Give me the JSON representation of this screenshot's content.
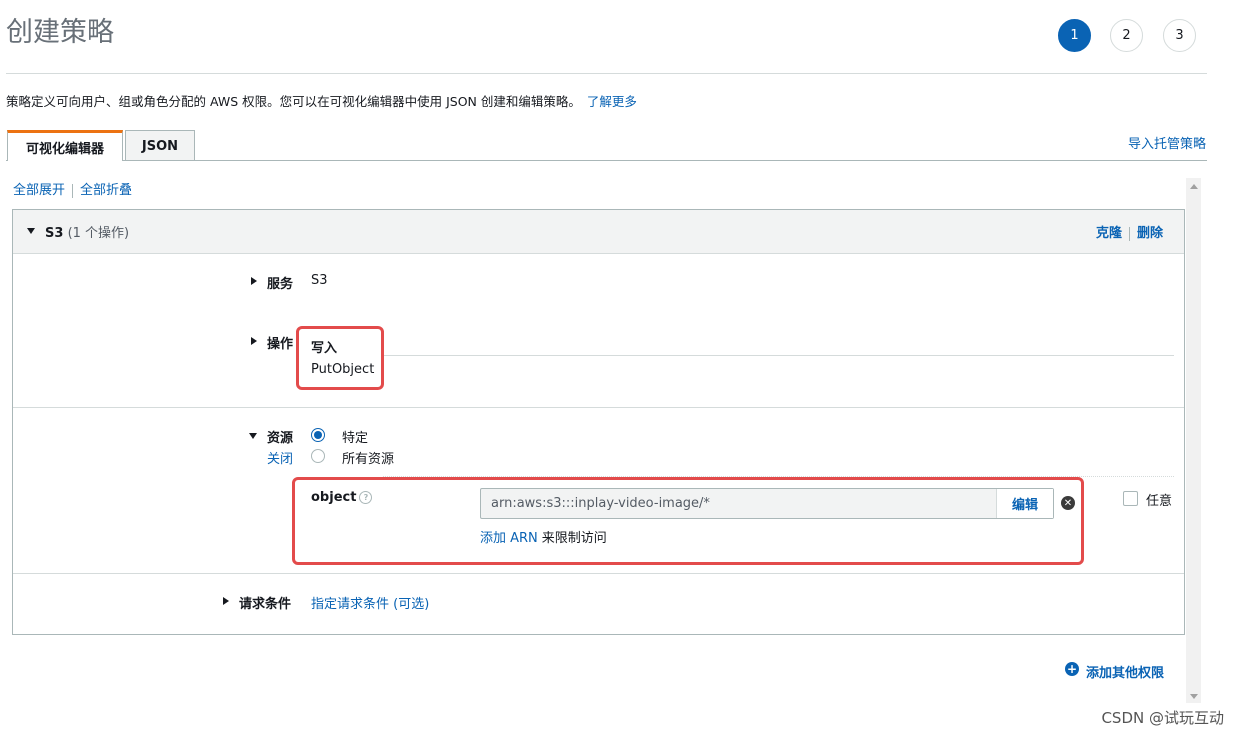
{
  "page": {
    "title": "创建策略",
    "steps": [
      "1",
      "2",
      "3"
    ],
    "description": "策略定义可向用户、组或角色分配的 AWS 权限。您可以在可视化编辑器中使用 JSON 创建和编辑策略。",
    "learn_more": "了解更多"
  },
  "tabs": [
    {
      "label": "可视化编辑器"
    },
    {
      "label": "JSON"
    }
  ],
  "import_link": "导入托管策略",
  "toolbar": {
    "expand_all": "全部展开",
    "collapse_all": "全部折叠"
  },
  "panel": {
    "title": "S3",
    "subtitle": "(1 个操作)",
    "clone": "克隆",
    "delete": "删除",
    "service": {
      "label": "服务",
      "value": "S3"
    },
    "actions": {
      "label": "操作",
      "group": "写入",
      "item": "PutObject"
    },
    "resources": {
      "label": "资源",
      "close": "关闭",
      "options": [
        "特定",
        "所有资源"
      ],
      "object_label": "object",
      "arn_value": "arn:aws:s3:::inplay-video-image/*",
      "edit": "编辑",
      "any_label": "任意",
      "add_arn": "添加 ARN",
      "add_arn_suffix": "来限制访问"
    },
    "conditions": {
      "label": "请求条件",
      "link": "指定请求条件 (可选)"
    }
  },
  "add_permissions": "添加其他权限",
  "watermark": "CSDN @试玩互动",
  "colors": {
    "accent": "#0a63b4",
    "tab_active_border": "#ec7211",
    "highlight": "#e34b4b"
  }
}
